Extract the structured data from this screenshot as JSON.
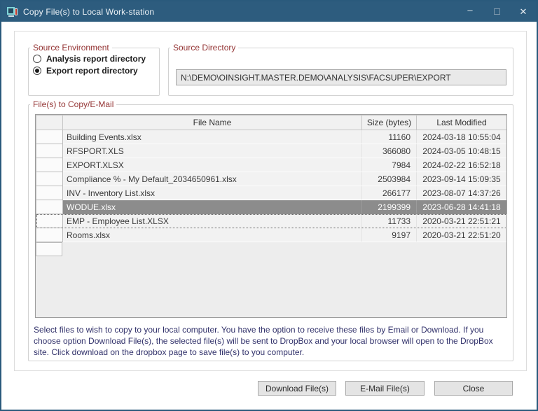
{
  "window": {
    "title": "Copy File(s) to Local Work-station",
    "controls": {
      "minimize": "–",
      "close": "✕"
    }
  },
  "source_environment": {
    "label": "Source Environment",
    "options": [
      {
        "label": "Analysis report directory",
        "selected": false
      },
      {
        "label": "Export report directory",
        "selected": true
      }
    ]
  },
  "source_directory": {
    "label": "Source Directory",
    "value": "N:\\DEMO\\OINSIGHT.MASTER.DEMO\\ANALYSIS\\FACSUPER\\EXPORT"
  },
  "files": {
    "label": "File(s) to Copy/E-Mail",
    "columns": [
      "File Name",
      "Size (bytes)",
      "Last Modified"
    ],
    "rows": [
      {
        "name": "Building Events.xlsx",
        "size": "11160",
        "modified": "2024-03-18 10:55:04"
      },
      {
        "name": "RFSPORT.XLS",
        "size": "366080",
        "modified": "2024-03-05 10:48:15"
      },
      {
        "name": "EXPORT.XLSX",
        "size": "7984",
        "modified": "2024-02-22 16:52:18"
      },
      {
        "name": "Compliance % - My Default_2034650961.xlsx",
        "size": "2503984",
        "modified": "2023-09-14 15:09:35"
      },
      {
        "name": "INV - Inventory List.xlsx",
        "size": "266177",
        "modified": "2023-08-07 14:37:26"
      },
      {
        "name": "WODUE.xlsx",
        "size": "2199399",
        "modified": "2023-06-28 14:41:18",
        "selected": true
      },
      {
        "name": "EMP - Employee List.XLSX",
        "size": "11733",
        "modified": "2020-03-21 22:51:21",
        "focused": true
      },
      {
        "name": "Rooms.xlsx",
        "size": "9197",
        "modified": "2020-03-21 22:51:20"
      }
    ]
  },
  "instructions": {
    "text": "Select files to wish to copy to your local computer.  You have the option to receive these files by Email or Download.  If you choose option Download File(s), the selected file(s) will be sent to DropBox and your local browser will open to the DropBox site.  Click download on the dropbox page to save file(s) to you computer."
  },
  "buttons": {
    "download": "Download File(s)",
    "email": "E-Mail File(s)",
    "close": "Close"
  },
  "colors": {
    "titlebar": "#2d5c7e",
    "group_label": "#943434",
    "instruction_text": "#32326b",
    "selected_row_bg": "#8c8c8c"
  }
}
